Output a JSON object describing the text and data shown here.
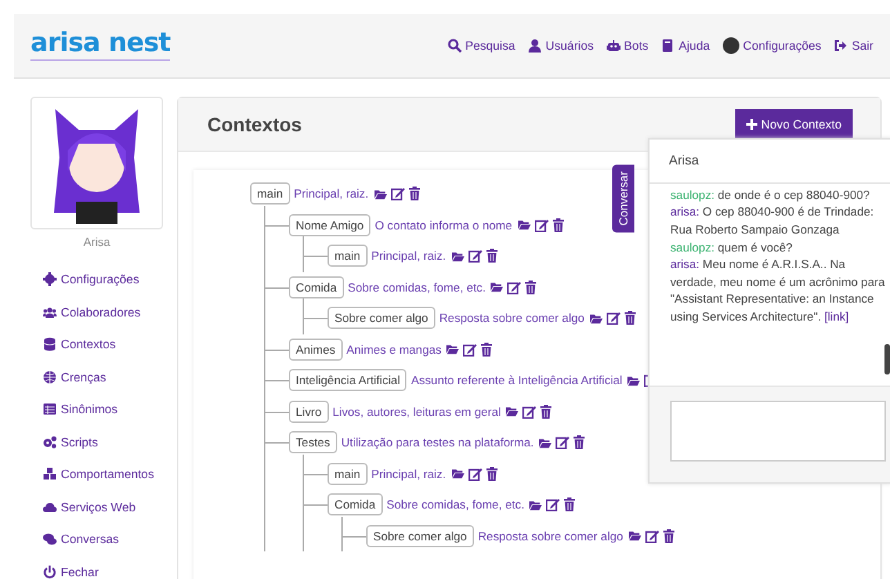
{
  "navbar": {
    "logo": "arisa nest",
    "links": [
      {
        "label": "Pesquisa",
        "kind": "search"
      },
      {
        "label": "Usuários",
        "kind": "user"
      },
      {
        "label": "Bots",
        "kind": "bot"
      },
      {
        "label": "Ajuda",
        "kind": "book"
      },
      {
        "label": "Configurações",
        "kind": "avatar"
      },
      {
        "label": "Sair",
        "kind": "exit"
      }
    ]
  },
  "sidebar": {
    "bot_name": "Arisa",
    "items": [
      {
        "label": "Configurações"
      },
      {
        "label": "Colaboradores"
      },
      {
        "label": "Contextos"
      },
      {
        "label": "Crenças"
      },
      {
        "label": "Sinônimos"
      },
      {
        "label": "Scripts"
      },
      {
        "label": "Comportamentos"
      },
      {
        "label": "Serviços Web"
      },
      {
        "label": "Conversas"
      },
      {
        "label": "Fechar"
      }
    ]
  },
  "main": {
    "title": "Contextos",
    "new_button": "Novo Contexto",
    "chat_tab": "Conversar",
    "tree": [
      {
        "name": "main",
        "description": "Principal, raiz.",
        "children": [
          {
            "name": "Nome Amigo",
            "description": "O contato informa o nome",
            "children": [
              {
                "name": "main",
                "description": "Principal, raiz."
              }
            ]
          },
          {
            "name": "Comida",
            "description": "Sobre comidas, fome, etc.",
            "children": [
              {
                "name": "Sobre comer algo",
                "description": "Resposta sobre comer algo"
              }
            ]
          },
          {
            "name": "Animes",
            "description": "Animes e mangas"
          },
          {
            "name": "Inteligência Artificial",
            "description": "Assunto referente à Inteligência Artificial"
          },
          {
            "name": "Livro",
            "description": "Livos, autores, leituras em geral"
          },
          {
            "name": "Testes",
            "description": "Utilização para testes na plataforma.",
            "children": [
              {
                "name": "main",
                "description": "Principal, raiz."
              },
              {
                "name": "Comida",
                "description": "Sobre comidas, fome, etc.",
                "children": [
                  {
                    "name": "Sobre comer algo",
                    "description": "Resposta sobre comer algo"
                  }
                ]
              }
            ]
          }
        ]
      }
    ]
  },
  "chat": {
    "title": "Arisa",
    "messages": [
      {
        "speaker": "saulopz:",
        "kind": "user",
        "text": "de onde é o cep 88040-900?"
      },
      {
        "speaker": "arisa:",
        "kind": "bot",
        "text": "O cep 88040-900 é de Trindade: Rua Roberto Sampaio Gonzaga"
      },
      {
        "speaker": "saulopz:",
        "kind": "user",
        "text": "quem é você?"
      },
      {
        "speaker": "arisa:",
        "kind": "bot",
        "text": "Meu nome é A.R.I.S.A.. Na verdade, meu nome é um acrônimo para \"Assistant Representative: an Instance using Services Architecture\".",
        "link": "[link]"
      }
    ]
  }
}
